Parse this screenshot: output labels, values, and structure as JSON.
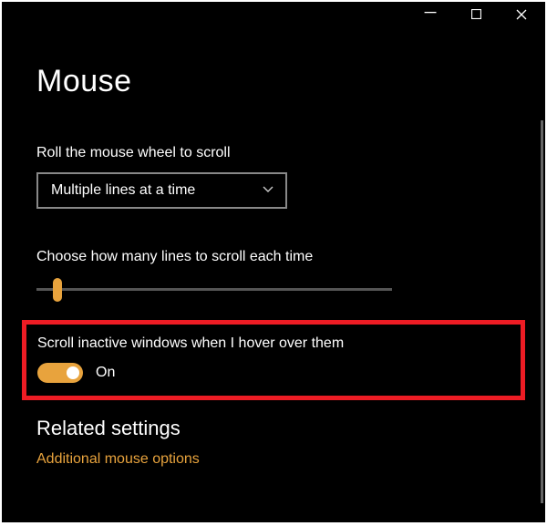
{
  "window": {
    "title": "Mouse"
  },
  "scroll": {
    "wheel_label": "Roll the mouse wheel to scroll",
    "wheel_value": "Multiple lines at a time",
    "lines_label": "Choose how many lines to scroll each time",
    "inactive_label": "Scroll inactive windows when I hover over them",
    "inactive_state": "On"
  },
  "related": {
    "heading": "Related settings",
    "link1": "Additional mouse options"
  },
  "colors": {
    "accent": "#e8a33d"
  }
}
